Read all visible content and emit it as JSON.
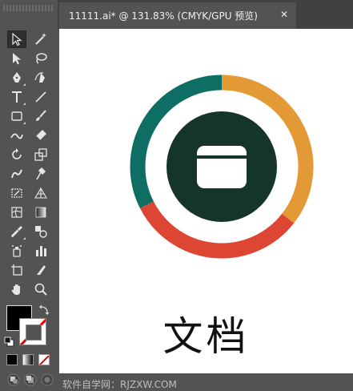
{
  "document_tab": {
    "title": "11111.ai* @ 131.83% (CMYK/GPU 预览)",
    "close_glyph": "✕"
  },
  "toolbar": {
    "tools": [
      {
        "name": "selection-tool-icon",
        "active": true
      },
      {
        "name": "magic-wand-tool-icon"
      },
      {
        "name": "direct-selection-tool-icon"
      },
      {
        "name": "lasso-tool-icon"
      },
      {
        "name": "pen-tool-icon"
      },
      {
        "name": "curvature-tool-icon"
      },
      {
        "name": "type-tool-icon"
      },
      {
        "name": "line-segment-tool-icon"
      },
      {
        "name": "rectangle-tool-icon"
      },
      {
        "name": "paintbrush-tool-icon"
      },
      {
        "name": "shaper-tool-icon"
      },
      {
        "name": "eraser-tool-icon"
      },
      {
        "name": "rotate-tool-icon"
      },
      {
        "name": "scale-tool-icon"
      },
      {
        "name": "warp-tool-icon"
      },
      {
        "name": "puppet-warp-tool-icon"
      },
      {
        "name": "free-transform-tool-icon"
      },
      {
        "name": "perspective-grid-tool-icon"
      },
      {
        "name": "mesh-tool-icon"
      },
      {
        "name": "gradient-tool-icon"
      },
      {
        "name": "eyedropper-tool-icon"
      },
      {
        "name": "blend-tool-icon"
      },
      {
        "name": "symbol-sprayer-tool-icon"
      },
      {
        "name": "column-graph-tool-icon"
      },
      {
        "name": "artboard-tool-icon"
      },
      {
        "name": "slice-tool-icon"
      },
      {
        "name": "hand-tool-icon"
      },
      {
        "name": "zoom-tool-icon"
      }
    ],
    "fill_color": "#000000",
    "stroke_color": "none"
  },
  "artwork": {
    "ring_colors": {
      "teal": "#0e6e64",
      "orange": "#e39a36",
      "red": "#dc4633"
    },
    "inner_circle_color": "#15342a",
    "icon": "card-window-icon",
    "label": "文档"
  },
  "watermark": "软件自学网：RJZXW.COM"
}
